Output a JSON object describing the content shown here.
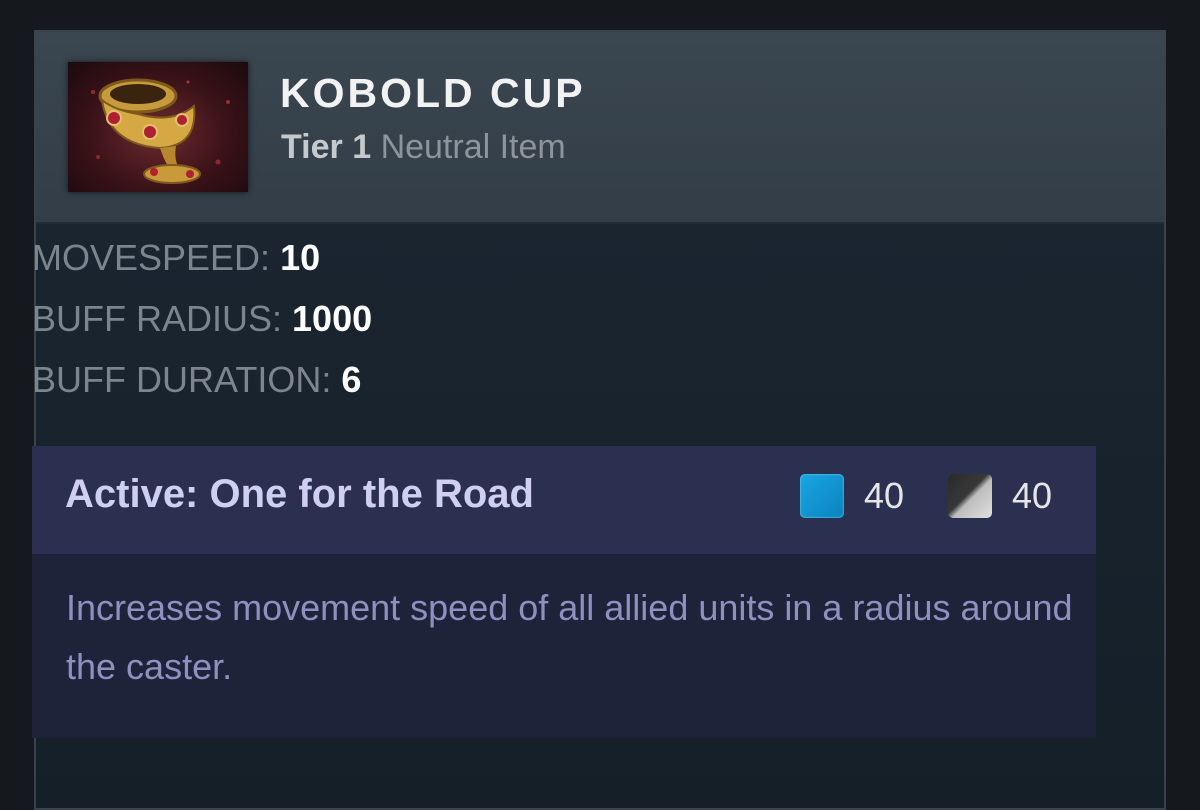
{
  "item": {
    "name": "KOBOLD CUP",
    "tier": "Tier 1",
    "type": "Neutral Item",
    "icon": "golden-goblet-icon"
  },
  "stats": [
    {
      "label": "MOVESPEED:",
      "value": "10"
    },
    {
      "label": "BUFF RADIUS:",
      "value": "1000"
    },
    {
      "label": "BUFF DURATION:",
      "value": "6"
    }
  ],
  "ability": {
    "name": "Active: One for the Road",
    "mana_cost": "40",
    "cooldown": "40",
    "description": "Increases movement speed of all allied units in a radius around the caster."
  },
  "colors": {
    "ability_name": "#cfcef3",
    "description": "#8e90bf",
    "mana": "#1aa6e2"
  }
}
